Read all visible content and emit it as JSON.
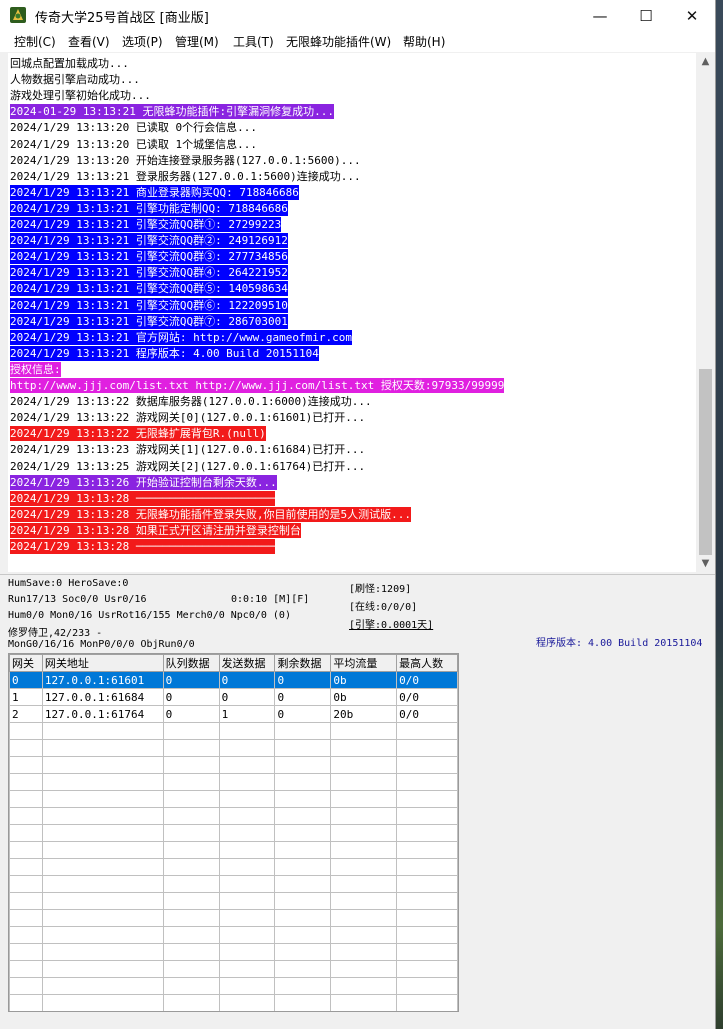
{
  "window": {
    "title": "传奇大学25号首战区 [商业版]",
    "minimize_glyph": "—",
    "maximize_glyph": "☐",
    "close_glyph": "✕"
  },
  "menu": [
    "控制(C)",
    "查看(V)",
    "选项(P)",
    "管理(M)",
    "工具(T)",
    "无限蜂功能插件(W)",
    "帮助(H)"
  ],
  "log": [
    {
      "text": "回城点配置加载成功...",
      "style": "plain"
    },
    {
      "text": "人物数据引擎启动成功...",
      "style": "plain"
    },
    {
      "text": "游戏处理引擎初始化成功...",
      "style": "plain"
    },
    {
      "text": "2024-01-29 13:13:21 无限蜂功能插件:引擎漏洞修复成功...",
      "style": "purple"
    },
    {
      "text": "2024/1/29 13:13:20 已读取 0个行会信息...",
      "style": "plain"
    },
    {
      "text": "2024/1/29 13:13:20 已读取 1个城堡信息...",
      "style": "plain"
    },
    {
      "text": "2024/1/29 13:13:20 开始连接登录服务器(127.0.0.1:5600)...",
      "style": "plain"
    },
    {
      "text": "2024/1/29 13:13:21 登录服务器(127.0.0.1:5600)连接成功...",
      "style": "plain"
    },
    {
      "text": "2024/1/29 13:13:21 商业登录器购买QQ: 718846686",
      "style": "blue"
    },
    {
      "text": "2024/1/29 13:13:21 引擎功能定制QQ: 718846686",
      "style": "blue"
    },
    {
      "text": "2024/1/29 13:13:21 引擎交流QQ群①: 27299223",
      "style": "blue"
    },
    {
      "text": "2024/1/29 13:13:21 引擎交流QQ群②: 249126912",
      "style": "blue"
    },
    {
      "text": "2024/1/29 13:13:21 引擎交流QQ群③: 277734856",
      "style": "blue"
    },
    {
      "text": "2024/1/29 13:13:21 引擎交流QQ群④: 264221952",
      "style": "blue"
    },
    {
      "text": "2024/1/29 13:13:21 引擎交流QQ群⑤: 140598634",
      "style": "blue"
    },
    {
      "text": "2024/1/29 13:13:21 引擎交流QQ群⑥: 122209510",
      "style": "blue"
    },
    {
      "text": "2024/1/29 13:13:21 引擎交流QQ群⑦: 286703001",
      "style": "blue"
    },
    {
      "text": "2024/1/29 13:13:21 官方网站: http://www.gameofmir.com",
      "style": "blue"
    },
    {
      "text": "2024/1/29 13:13:21 程序版本: 4.00 Build 20151104",
      "style": "blue"
    },
    {
      "text": "授权信息:",
      "style": "magenta"
    },
    {
      "text": "http://www.jjj.com/list.txt http://www.jjj.com/list.txt 授权天数:97933/99999",
      "style": "magenta"
    },
    {
      "text": "2024/1/29 13:13:22 数据库服务器(127.0.0.1:6000)连接成功...",
      "style": "plain"
    },
    {
      "text": "2024/1/29 13:13:22 游戏网关[0](127.0.0.1:61601)已打开...",
      "style": "plain"
    },
    {
      "text": "2024/1/29 13:13:22 无限蜂扩展背包R.(null)",
      "style": "red"
    },
    {
      "text": "2024/1/29 13:13:23 游戏网关[1](127.0.0.1:61684)已打开...",
      "style": "plain"
    },
    {
      "text": "2024/1/29 13:13:25 游戏网关[2](127.0.0.1:61764)已打开...",
      "style": "plain"
    },
    {
      "text": "2024/1/29 13:13:26 开始验证控制台剩余天数...",
      "style": "purple"
    },
    {
      "text": "2024/1/29 13:13:28 ─────────────────────",
      "style": "red"
    },
    {
      "text": "2024/1/29 13:13:28 无限蜂功能插件登录失败,你目前使用的是5人测试版...",
      "style": "red"
    },
    {
      "text": "2024/1/29 13:13:28 如果正式开区请注册并登录控制台",
      "style": "red"
    },
    {
      "text": "2024/1/29 13:13:28 ─────────────────────",
      "style": "red"
    }
  ],
  "status": {
    "hum_save": "HumSave:0 HeroSave:0",
    "run": "Run17/13 Soc0/0 Usr0/16",
    "timer": "0:0:10 [M][F]",
    "hum": "Hum0/0 Mon0/16 UsrRot16/155 Merch0/0 Npc0/0 (0)",
    "guard": "修罗侍卫,42/233 -",
    "mong": "MonG0/16/16 MonP0/0/0 ObjRun0/0",
    "refresh_monster": "[刷怪:1209]",
    "online": "[在线:0/0/0]",
    "engine": "[引擎:0.0001天]",
    "version": "程序版本: 4.00 Build 20151104"
  },
  "gateway_table": {
    "columns": [
      "网关",
      "网关地址",
      "队列数据",
      "发送数据",
      "剩余数据",
      "平均流量",
      "最高人数"
    ],
    "rows": [
      [
        "0",
        "127.0.0.1:61601",
        "0",
        "0",
        "0",
        "0b",
        "0/0"
      ],
      [
        "1",
        "127.0.0.1:61684",
        "0",
        "0",
        "0",
        "0b",
        "0/0"
      ],
      [
        "2",
        "127.0.0.1:61764",
        "0",
        "1",
        "0",
        "20b",
        "0/0"
      ]
    ],
    "selected_row": 0
  },
  "icons": {
    "app": "game-app-icon",
    "scroll_up": "chevron-up-icon",
    "scroll_down": "chevron-down-icon"
  }
}
